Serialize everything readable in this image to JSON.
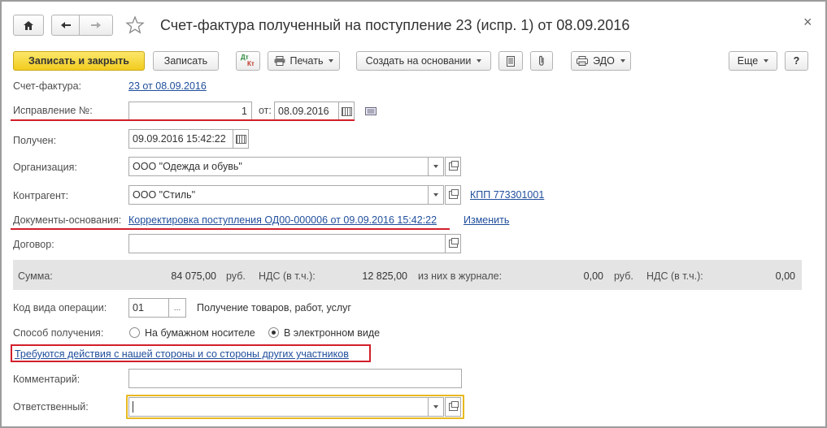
{
  "window": {
    "title": "Счет-фактура полученный на поступление 23 (испр. 1) от 08.09.2016",
    "close": "×"
  },
  "toolbar": {
    "save_close": "Записать и закрыть",
    "save": "Записать",
    "print": "Печать",
    "create_based": "Создать на основании",
    "edo": "ЭДО",
    "more": "Еще",
    "help": "?",
    "dt_kt_top": "Дт",
    "dt_kt_bottom": "Кт"
  },
  "form": {
    "invoice_label": "Счет-фактура:",
    "invoice_link": "23 от 08.09.2016",
    "correction_label": "Исправление №:",
    "correction_value": "1",
    "from_label": "от:",
    "correction_date": "08.09.2016",
    "received_label": "Получен:",
    "received_value": "09.09.2016 15:42:22",
    "org_label": "Организация:",
    "org_value": "ООО \"Одежда и обувь\"",
    "contractor_label": "Контрагент:",
    "contractor_value": "ООО \"Стиль\"",
    "kpp_link": "КПП 773301001",
    "docs_label": "Документы-основания:",
    "docs_link": "Корректировка поступления ОД00-000006 от 09.09.2016 15:42:22",
    "change_link": "Изменить",
    "contract_label": "Договор:",
    "contract_value": "",
    "op_code_label": "Код вида операции:",
    "op_code_value": "01",
    "op_code_button": "...",
    "op_code_desc": "Получение товаров, работ, услуг",
    "method_label": "Способ получения:",
    "method_paper": "На бумажном носителе",
    "method_electronic": "В электронном виде",
    "method_selected": "electronic",
    "actions_link": "Требуются действия с нашей стороны и со стороны других участников",
    "comment_label": "Комментарий:",
    "comment_value": "",
    "responsible_label": "Ответственный:",
    "responsible_value": ""
  },
  "summary": {
    "sum_label": "Сумма:",
    "sum_value": "84 075,00",
    "currency": "руб.",
    "vat_label": "НДС (в т.ч.):",
    "vat_value": "12 825,00",
    "journal_label": "из них в журнале:",
    "journal_value": "0,00",
    "journal_currency": "руб.",
    "journal_vat_label": "НДС (в т.ч.):",
    "journal_vat_value": "0,00"
  },
  "colors": {
    "accent_yellow": "#f2cc1f",
    "link": "#1f4e9c",
    "highlight_red": "#d21f2a",
    "focus_border": "#e8b820"
  }
}
